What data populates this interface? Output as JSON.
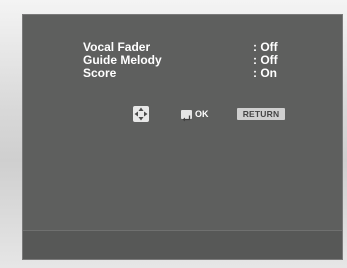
{
  "menu": {
    "items": [
      {
        "label": "Vocal Fader",
        "value": ": Off"
      },
      {
        "label": "Guide Melody",
        "value": ": Off"
      },
      {
        "label": "Score",
        "value": ": On"
      }
    ]
  },
  "controls": {
    "dpad_icon": "dpad-icon",
    "enter_icon": "enter-icon",
    "ok_label": "OK",
    "return_label": "RETURN"
  },
  "colors": {
    "screen_bg": "#5e5f5e",
    "text": "#ffffff",
    "button_bg": "#cfcfcf"
  }
}
